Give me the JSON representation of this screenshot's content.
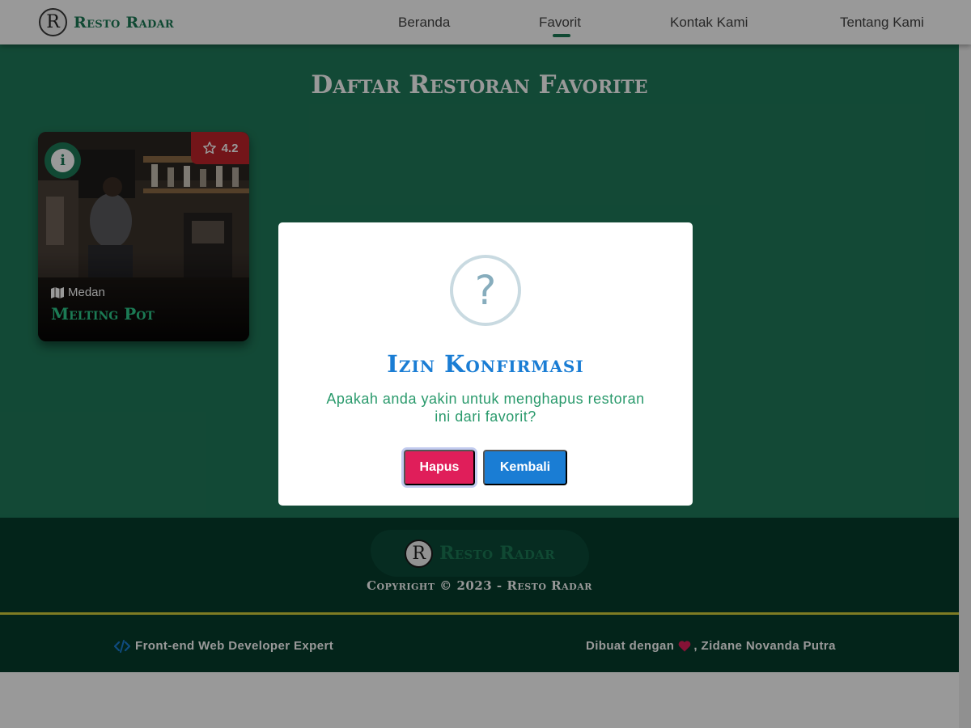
{
  "header": {
    "logo_letter": "R",
    "logo_text": "Resto Radar",
    "nav": {
      "beranda": "Beranda",
      "favorit": "Favorit",
      "kontak": "Kontak Kami",
      "tentang": "Tentang Kami"
    },
    "active_nav": "favorit"
  },
  "main": {
    "title": "Daftar Restoran Favorite",
    "restaurants": [
      {
        "name": "Melting Pot",
        "city": "Medan",
        "rating": "4.2"
      }
    ]
  },
  "dialog": {
    "icon": "question-icon",
    "title": "Izin Konfirmasi",
    "text": "Apakah anda yakin untuk menghapus restoran ini dari favorit?",
    "delete_label": "Hapus",
    "back_label": "Kembali"
  },
  "footer": {
    "logo_letter": "R",
    "logo_text": "Resto Radar",
    "copyright": "Copyright © 2023 - Resto Radar",
    "left_credit": "Front-end Web Developer Expert",
    "right_credit_prefix": "Dibuat dengan",
    "right_credit_suffix": ", Zidane Novanda Putra"
  },
  "colors": {
    "primary": "#1f7a5a",
    "footer": "#063c2c",
    "accent_line": "#d4cf3d",
    "delete": "#e01e5a",
    "back": "#1a7dd4"
  }
}
